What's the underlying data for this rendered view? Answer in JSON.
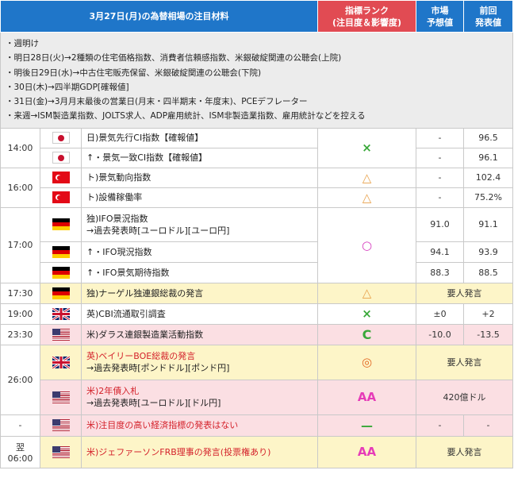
{
  "header": {
    "title": "3月27日(月)の為替相場の注目材料",
    "rank_line1": "指標ランク",
    "rank_line2": "(注目度＆影響度)",
    "forecast_line1": "市場",
    "forecast_line2": "予想値",
    "previous_line1": "前回",
    "previous_line2": "発表値"
  },
  "summary": [
    "・週明け",
    "・明日28日(火)→2種類の住宅価格指数、消費者信頼感指数、米銀破綻関連の公聴会(上院)",
    "・明後日29日(水)→中古住宅販売保留、米銀破綻関連の公聴会(下院)",
    "・30日(木)→四半期GDP[確報値]",
    "・31日(金)→3月月末最後の営業日(月末・四半期末・年度末)、PCEデフレーター",
    "・来週→ISM製造業指数、JOLTS求人、ADP雇用統計、ISM非製造業指数、雇用統計などを控える"
  ],
  "rows": {
    "r1400": {
      "time": "14:00",
      "rank": "×",
      "e1": {
        "flag": "jp",
        "line1": "日)景気先行CI指数【確報値】",
        "forecast": "-",
        "previous": "96.5"
      },
      "e2": {
        "flag": "jp",
        "line1": "↑・景気一致CI指数【確報値】",
        "forecast": "-",
        "previous": "96.1"
      }
    },
    "r1600": {
      "time": "16:00",
      "e1": {
        "flag": "tr",
        "line1": "ト)景気動向指数",
        "rank": "△",
        "forecast": "-",
        "previous": "102.4"
      },
      "e2": {
        "flag": "tr",
        "line1": "ト)設備稼働率",
        "rank": "△",
        "forecast": "-",
        "previous": "75.2%"
      }
    },
    "r1700": {
      "time": "17:00",
      "rank": "○",
      "e1": {
        "flag": "de",
        "line1": "独)IFO景況指数",
        "line2": "→過去発表時[ユーロドル][ユーロ円]",
        "forecast": "91.0",
        "previous": "91.1"
      },
      "e2": {
        "flag": "de",
        "line1": "↑・IFO現況指数",
        "forecast": "94.1",
        "previous": "93.9"
      },
      "e3": {
        "flag": "de",
        "line1": "↑・IFO景気期待指数",
        "forecast": "88.3",
        "previous": "88.5"
      }
    },
    "r1730": {
      "time": "17:30",
      "flag": "de",
      "line1": "独)ナーゲル独連銀総裁の発言",
      "rank": "△",
      "note": "要人発言"
    },
    "r1900": {
      "time": "19:00",
      "flag": "uk",
      "line1": "英)CBI流通取引調査",
      "rank": "×",
      "forecast": "±0",
      "previous": "+2"
    },
    "r2330": {
      "time": "23:30",
      "flag": "us",
      "line1": "米)ダラス連銀製造業活動指数",
      "rank": "C",
      "forecast": "-10.0",
      "previous": "-13.5"
    },
    "r2600": {
      "time": "26:00",
      "e1": {
        "flag": "uk",
        "line1": "英)ベイリーBOE総裁の発言",
        "line2": "→過去発表時[ポンドドル][ポンド円]",
        "rank": "◎",
        "note": "要人発言"
      },
      "e2": {
        "flag": "us",
        "line1": "米)2年債入札",
        "line2": "→過去発表時[ユーロドル][ドル円]",
        "rank": "AA",
        "note": "420億ドル"
      }
    },
    "rdash": {
      "time": "-",
      "flag": "us",
      "line1": "米)注目度の高い経済指標の発表はない",
      "rank": "—",
      "forecast": "-",
      "previous": "-"
    },
    "r0600": {
      "time_line1": "翌",
      "time_line2": "06:00",
      "flag": "us",
      "line1": "米)ジェファーソンFRB理事の発言(投票権あり)",
      "rank": "AA",
      "note": "要人発言"
    }
  },
  "colors": {
    "header_blue": "#1f76c9",
    "header_red": "#e14b53",
    "summary_gray": "#ececec",
    "highlight_yellow": "#fdf5c8",
    "highlight_pink": "#fbdfe3",
    "rank_green": "#3aa83a",
    "rank_orange": "#e8a24c",
    "rank_magenta": "#d63cbf",
    "text_red": "#d4222b"
  }
}
